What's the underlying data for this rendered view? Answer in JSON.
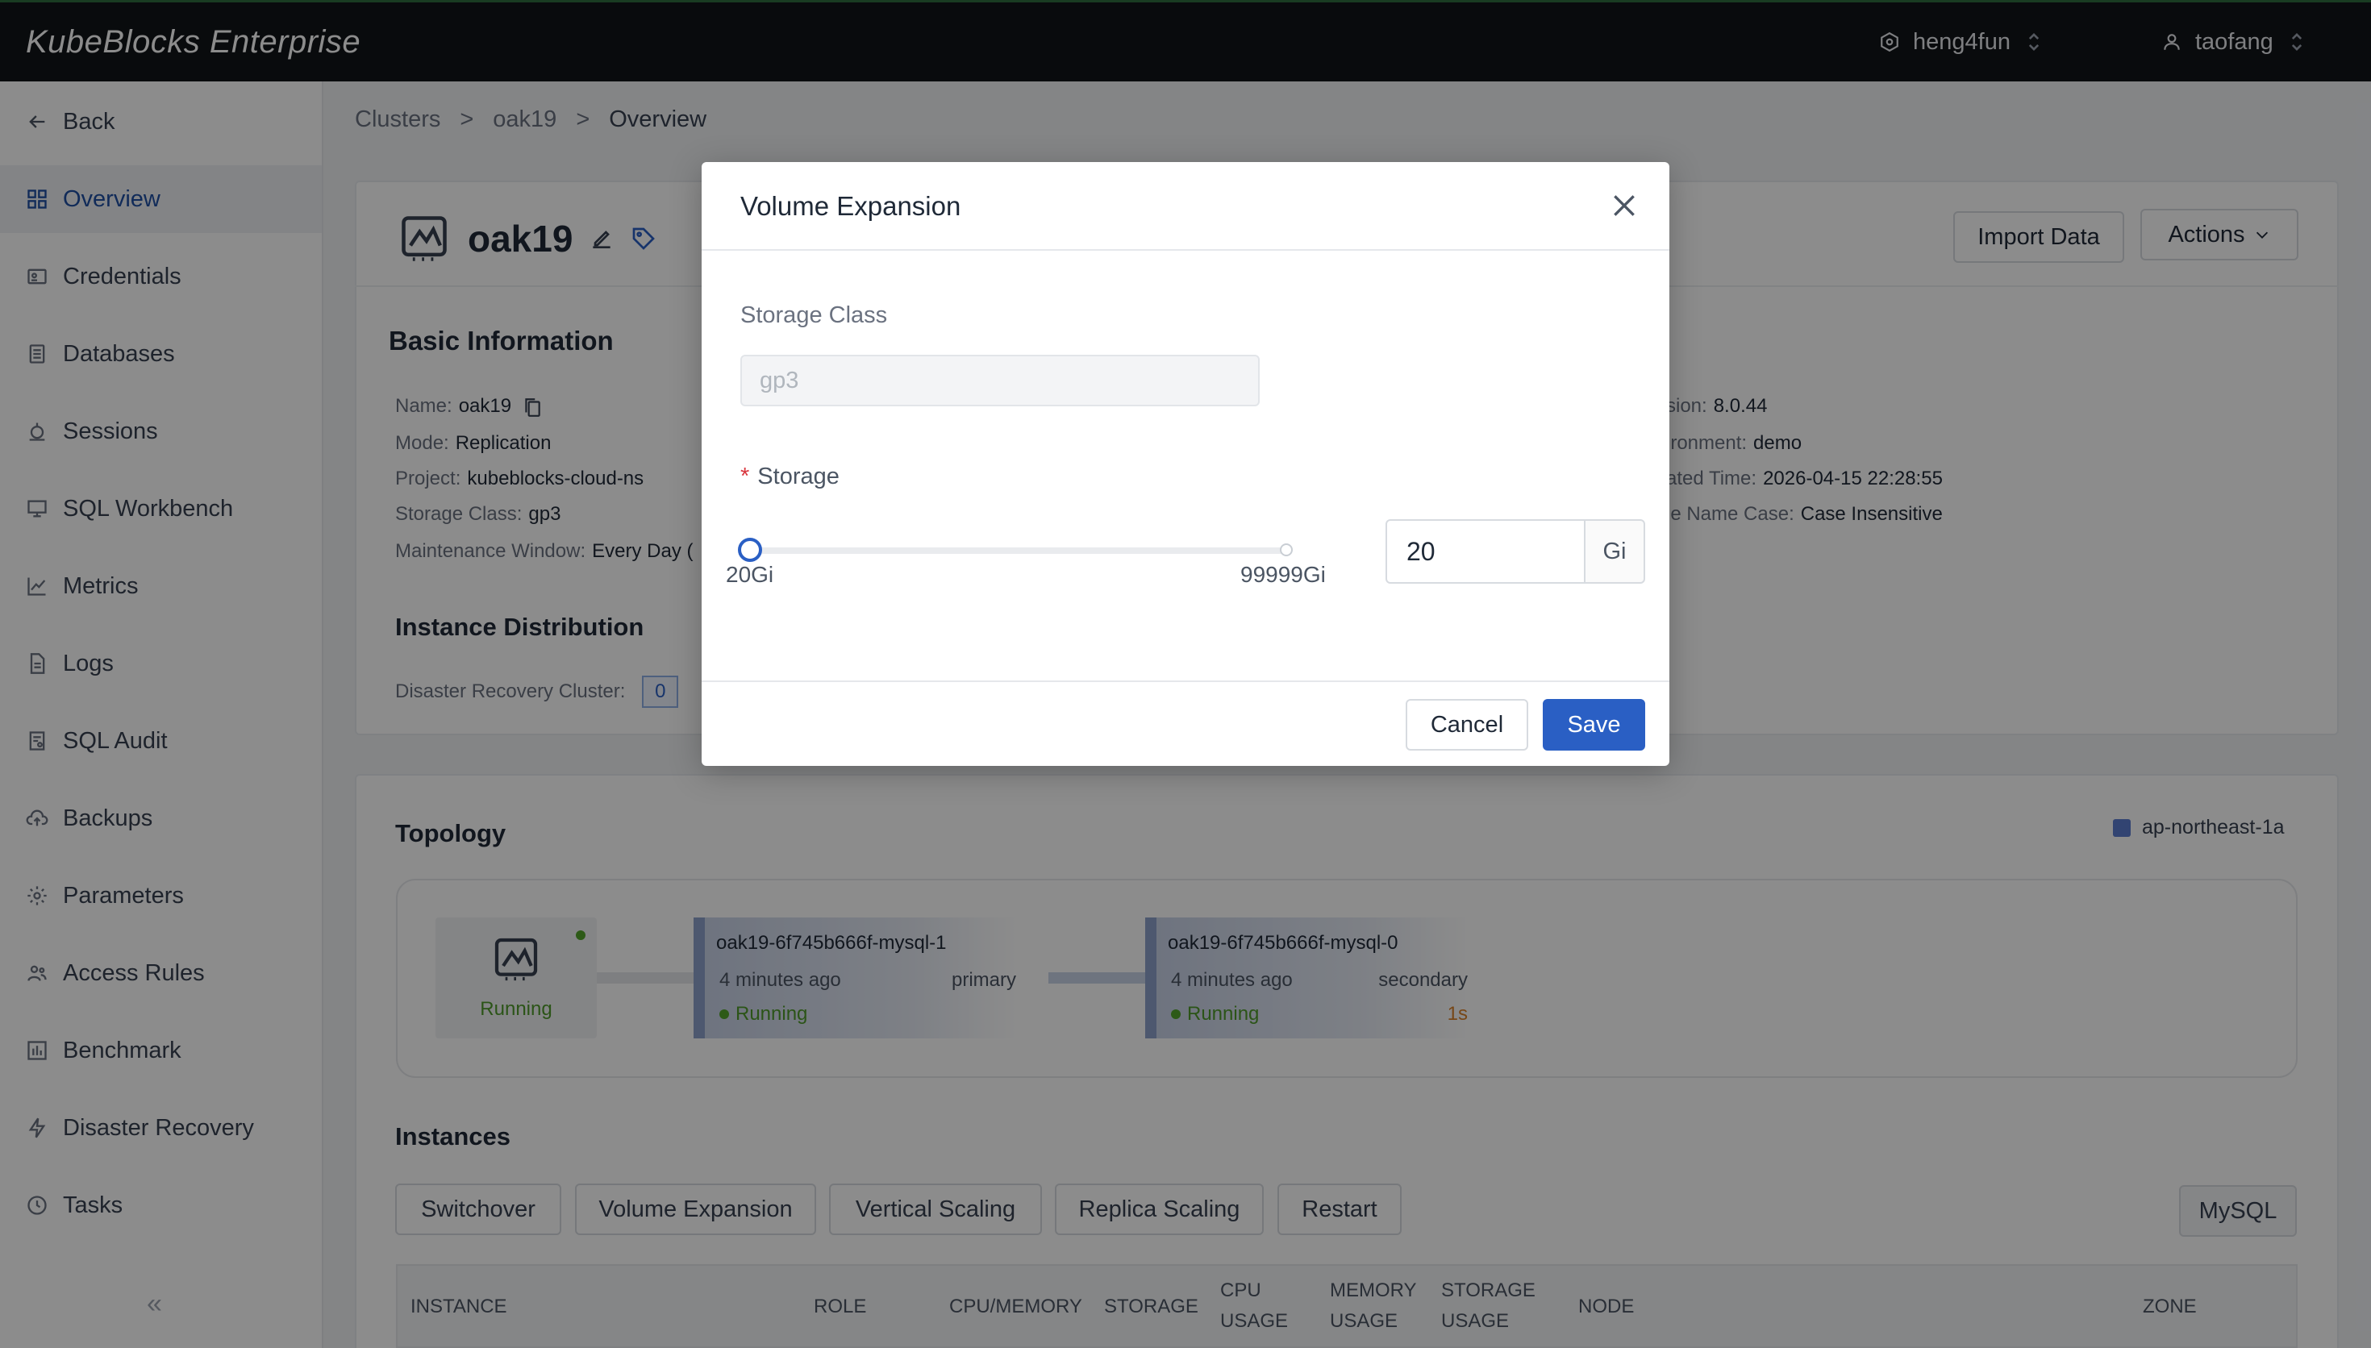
{
  "app": {
    "brand": "KubeBlocks Enterprise",
    "org": "heng4fun",
    "user": "taofang"
  },
  "sidebar": {
    "back": "Back",
    "items": [
      {
        "label": "Overview",
        "icon": "grid-icon"
      },
      {
        "label": "Credentials",
        "icon": "id-card-icon"
      },
      {
        "label": "Databases",
        "icon": "database-icon"
      },
      {
        "label": "Sessions",
        "icon": "sessions-icon"
      },
      {
        "label": "SQL Workbench",
        "icon": "monitor-icon"
      },
      {
        "label": "Metrics",
        "icon": "chart-icon"
      },
      {
        "label": "Logs",
        "icon": "file-icon"
      },
      {
        "label": "SQL Audit",
        "icon": "audit-icon"
      },
      {
        "label": "Backups",
        "icon": "cloud-upload-icon"
      },
      {
        "label": "Parameters",
        "icon": "gear-icon"
      },
      {
        "label": "Access Rules",
        "icon": "users-icon"
      },
      {
        "label": "Benchmark",
        "icon": "benchmark-icon"
      },
      {
        "label": "Disaster Recovery",
        "icon": "bolt-icon"
      },
      {
        "label": "Tasks",
        "icon": "clock-icon"
      }
    ],
    "collapse": "«"
  },
  "breadcrumb": [
    "Clusters",
    "oak19",
    "Overview"
  ],
  "cluster": {
    "name": "oak19",
    "import_label": "Import Data",
    "actions_label": "Actions"
  },
  "basic_info": {
    "title": "Basic Information",
    "left": [
      {
        "k": "Name:",
        "v": "oak19"
      },
      {
        "k": "Mode:",
        "v": "Replication"
      },
      {
        "k": "Project:",
        "v": "kubeblocks-cloud-ns"
      },
      {
        "k": "Storage Class:",
        "v": "gp3"
      },
      {
        "k": "Maintenance Window:",
        "v": "Every Day ("
      }
    ],
    "right": [
      {
        "k": "sion:",
        "v": "8.0.44"
      },
      {
        "k": "ironment:",
        "v": "demo"
      },
      {
        "k": "ated Time:",
        "v": "2026-04-15 22:28:55"
      },
      {
        "k": "le Name Case:",
        "v": "Case Insensitive"
      }
    ]
  },
  "instance_distribution": {
    "title": "Instance Distribution",
    "dr_label": "Disaster Recovery Cluster:",
    "dr_value": "0"
  },
  "topology": {
    "title": "Topology",
    "zone": "ap-northeast-1a",
    "cluster_status": "Running",
    "instances": [
      {
        "name": "oak19-6f745b666f-mysql-1",
        "age": "4 minutes ago",
        "role": "primary",
        "status": "Running",
        "delay": ""
      },
      {
        "name": "oak19-6f745b666f-mysql-0",
        "age": "4 minutes ago",
        "role": "secondary",
        "status": "Running",
        "delay": "1s"
      }
    ]
  },
  "instances_section": {
    "title": "Instances",
    "buttons": [
      "Switchover",
      "Volume Expansion",
      "Vertical Scaling",
      "Replica Scaling",
      "Restart"
    ],
    "engine": "MySQL",
    "columns": [
      "INSTANCE",
      "ROLE",
      "CPU/MEMORY",
      "STORAGE",
      "CPU USAGE",
      "MEMORY USAGE",
      "STORAGE USAGE",
      "NODE",
      "ZONE"
    ]
  },
  "modal": {
    "title": "Volume Expansion",
    "storage_class_label": "Storage Class",
    "storage_class_value": "gp3",
    "storage_label": "Storage",
    "required_mark": "*",
    "slider_min": "20Gi",
    "slider_max": "99999Gi",
    "slider_value_fraction": 0,
    "storage_value": "20",
    "storage_unit": "Gi",
    "cancel": "Cancel",
    "save": "Save"
  },
  "colors": {
    "accent": "#2a5fc4",
    "topbar": "#111418",
    "running": "#52a52b",
    "delay": "#d9822b"
  }
}
